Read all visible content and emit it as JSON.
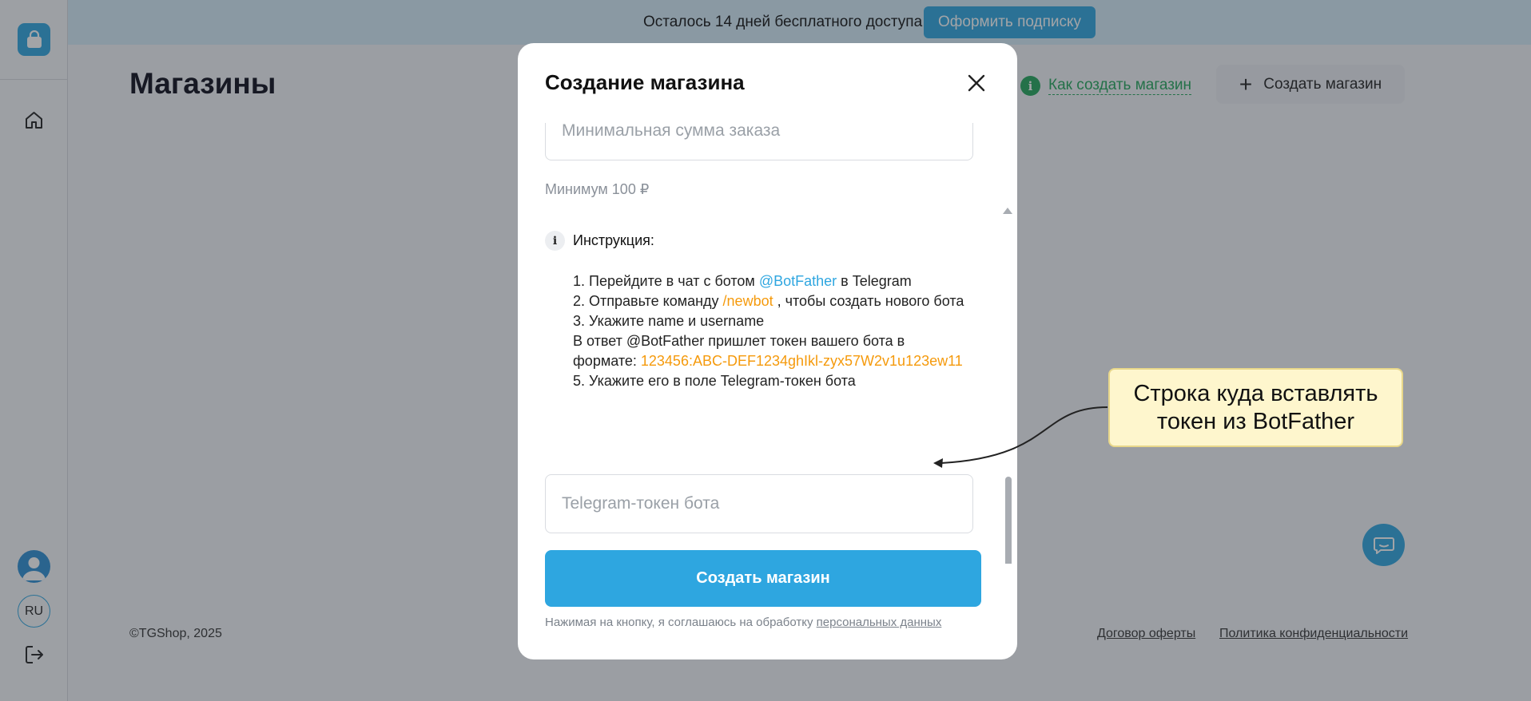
{
  "banner": {
    "trial_text": "Осталось 14 дней бесплатного доступа",
    "subscribe_label": "Оформить подписку"
  },
  "sidebar": {
    "lang": "RU",
    "icons": [
      "bag-icon",
      "home-icon",
      "avatar",
      "logout-icon"
    ]
  },
  "page": {
    "title": "Магазины",
    "howto_link": "Как создать магазин",
    "create_button": "Создать магазин"
  },
  "footer": {
    "copyright": "©TGShop, 2025",
    "offer": "Договор оферты",
    "privacy": "Политика конфиденциальности"
  },
  "modal": {
    "title": "Создание магазина",
    "min_order_placeholder": "Минимальная сумма заказа",
    "min_order_hint": "Минимум 100 ₽",
    "instruction_title": "Инструкция:",
    "steps": {
      "s1_pre": "1. Перейдите в чат с ботом ",
      "s1_link": "@BotFather",
      "s1_post": " в Telegram",
      "s2_pre": "2. Отправьте команду ",
      "s2_cmd": "/newbot",
      "s2_post": " , чтобы создать нового бота",
      "s3": "3. Укажите name и username",
      "s4_pre": "В ответ @BotFather пришлет токен вашего бота в формате: ",
      "s4_token": "123456:ABC-DEF1234ghIkl-zyx57W2v1u123ew11",
      "s5": "5. Укажите его в поле Telegram-токен бота"
    },
    "token_placeholder": "Telegram-токен бота",
    "submit_label": "Создать магазин",
    "consent_text": "Нажимая на кнопку, я соглашаюсь на обработку ",
    "consent_link": "персональных данных"
  },
  "callout": {
    "text": "Строка куда вставлять токен из BotFather"
  },
  "colors": {
    "accent": "#2ea6e0",
    "link_green": "#23a65b",
    "highlight_orange": "#f59a0c",
    "callout_bg": "#fef6cd"
  }
}
